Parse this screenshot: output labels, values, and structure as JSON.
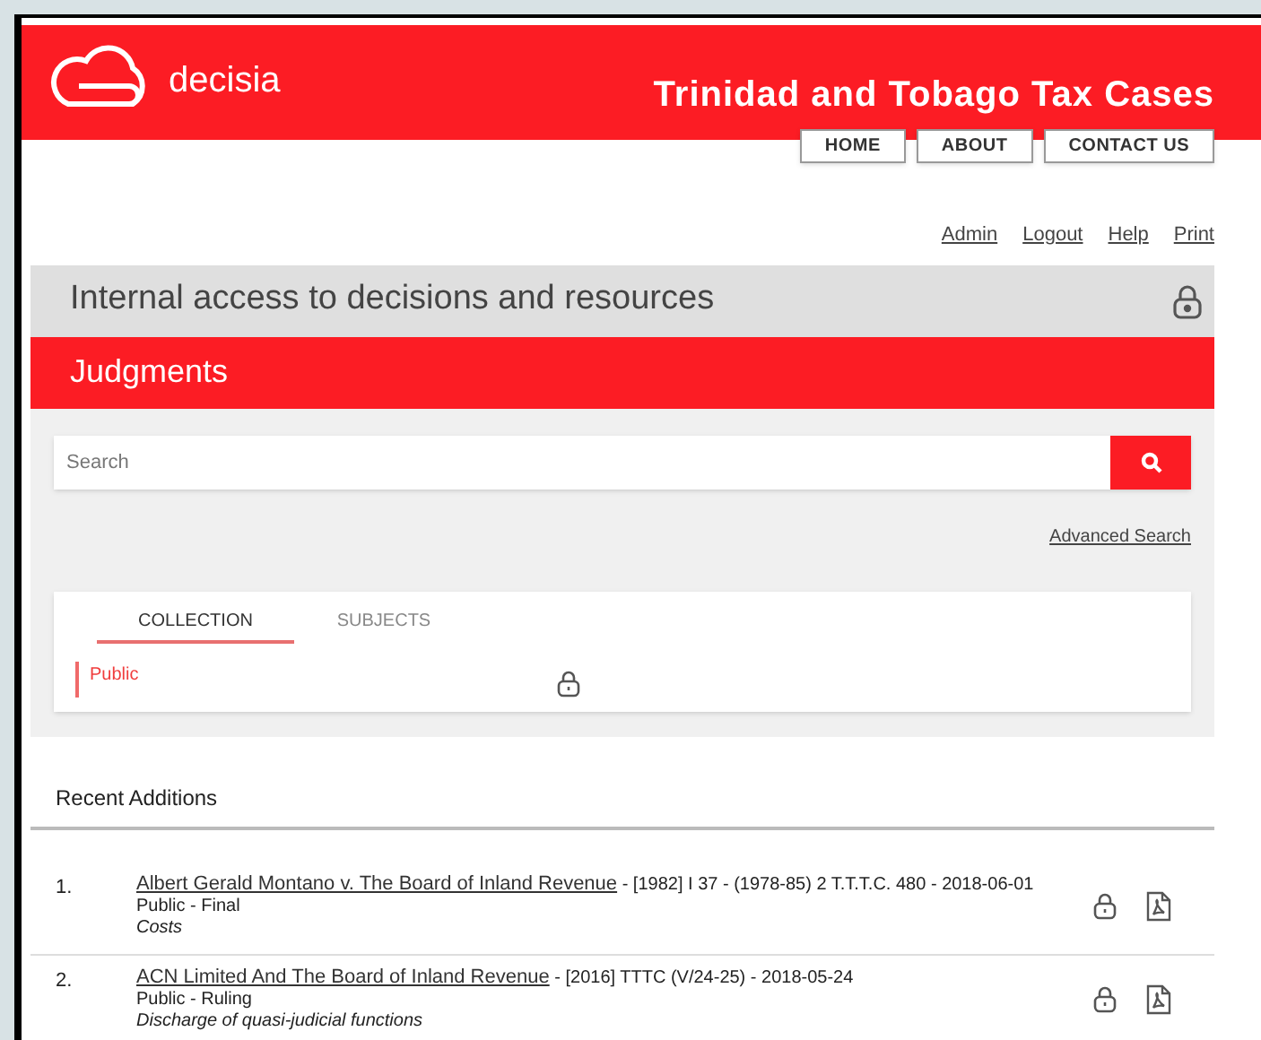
{
  "header": {
    "logo_text": "decisia",
    "site_title": "Trinidad and Tobago Tax Cases",
    "nav": [
      "HOME",
      "ABOUT",
      "CONTACT US"
    ]
  },
  "user_links": [
    "Admin",
    "Logout",
    "Help",
    "Print"
  ],
  "panel": {
    "title": "Internal access to decisions and resources",
    "section": "Judgments",
    "search": {
      "placeholder": "Search"
    },
    "advanced_search": "Advanced Search",
    "tabs": [
      {
        "label": "COLLECTION",
        "selected": true
      },
      {
        "label": "SUBJECTS",
        "selected": false
      }
    ],
    "collections": [
      {
        "label": "Public",
        "selected": true
      }
    ]
  },
  "recent": {
    "heading": "Recent Additions",
    "items": [
      {
        "number": "1.",
        "title": "Albert Gerald Montano v. The Board of Inland Revenue",
        "citation": " - [1982] I 37 - (1978-85) 2 T.T.T.C. 480 - 2018-06-01",
        "status": "Public - Final",
        "subject": "Costs"
      },
      {
        "number": "2.",
        "title": "ACN Limited And The Board of Inland Revenue",
        "citation": " - [2016] TTTC (V/24-25) - 2018-05-24",
        "status": "Public - Ruling",
        "subject": "Discharge of quasi-judicial functions"
      }
    ]
  }
}
